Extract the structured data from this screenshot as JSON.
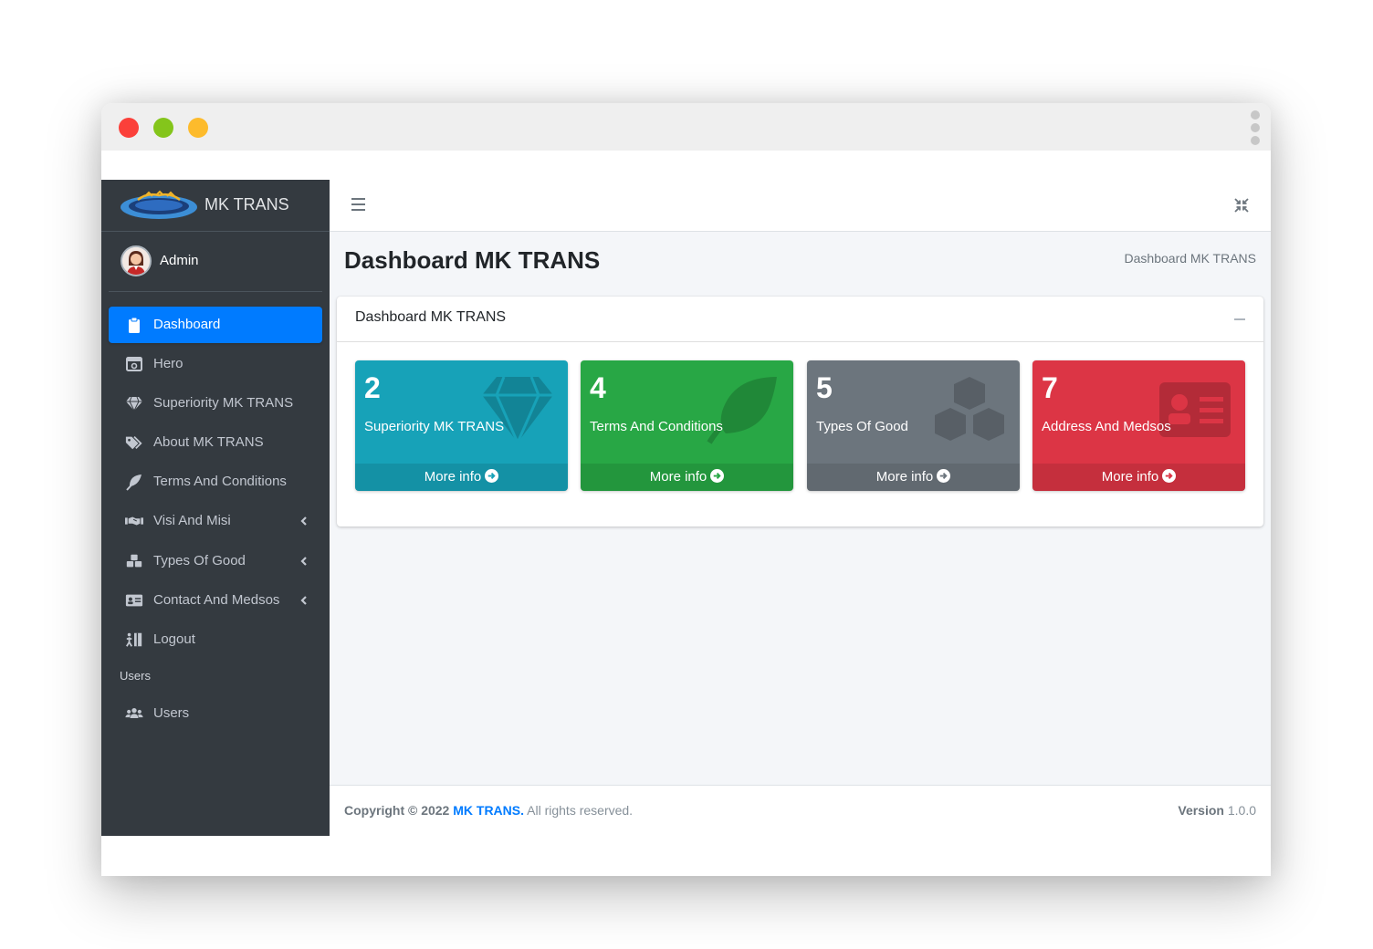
{
  "brand": {
    "name": "MK TRANS"
  },
  "user": {
    "name": "Admin"
  },
  "sidebar": {
    "items": [
      {
        "label": "Dashboard",
        "icon": "clipboard-icon",
        "active": true
      },
      {
        "label": "Hero",
        "icon": "window-icon"
      },
      {
        "label": "Superiority MK TRANS",
        "icon": "gem-icon"
      },
      {
        "label": "About MK TRANS",
        "icon": "tags-icon"
      },
      {
        "label": "Terms And Conditions",
        "icon": "feather-icon"
      },
      {
        "label": "Visi And Misi",
        "icon": "handshake-icon",
        "has_submenu": true
      },
      {
        "label": "Types Of Good",
        "icon": "boxes-icon",
        "has_submenu": true
      },
      {
        "label": "Contact And Medsos",
        "icon": "address-card-icon",
        "has_submenu": true
      },
      {
        "label": "Logout",
        "icon": "door-exit-icon"
      }
    ],
    "header": "Users",
    "users_item": {
      "label": "Users",
      "icon": "users-icon"
    }
  },
  "page": {
    "title": "Dashboard MK TRANS",
    "breadcrumb": "Dashboard MK TRANS"
  },
  "card": {
    "title": "Dashboard MK TRANS"
  },
  "boxes": [
    {
      "count": "2",
      "label": "Superiority MK TRANS",
      "link": "More info",
      "icon": "gem-icon",
      "color": "#17a2b8"
    },
    {
      "count": "4",
      "label": "Terms And Conditions",
      "link": "More info",
      "icon": "leaf-icon",
      "color": "#28a745"
    },
    {
      "count": "5",
      "label": "Types Of Good",
      "link": "More info",
      "icon": "cubes-icon",
      "color": "#6c757d"
    },
    {
      "count": "7",
      "label": "Address And Medsos",
      "link": "More info",
      "icon": "id-card-icon",
      "color": "#dc3545"
    }
  ],
  "footer": {
    "copyright_prefix": "Copyright © 2022",
    "brand_link": "MK TRANS.",
    "rights": "All rights reserved.",
    "version_label": "Version",
    "version_value": "1.0.0"
  },
  "colors": {
    "sidebar": "#343a40",
    "active": "#007bff",
    "content_bg": "#f4f6f9"
  }
}
